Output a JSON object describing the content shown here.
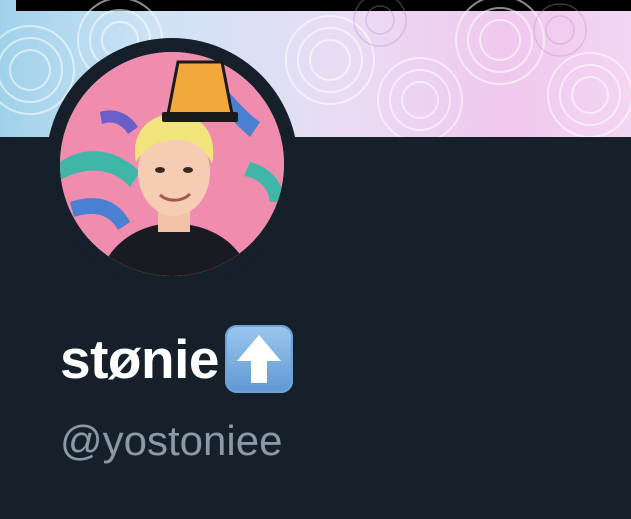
{
  "profile": {
    "display_name": "støn‌ie",
    "handle": "@yostoniee",
    "name_emoji": "up-arrow-emoji",
    "avatar": "profile-avatar-illustration"
  },
  "colors": {
    "background": "#15202b",
    "name": "#ffffff",
    "handle": "#8b98a5",
    "avatar_bg": "#f08cae"
  }
}
